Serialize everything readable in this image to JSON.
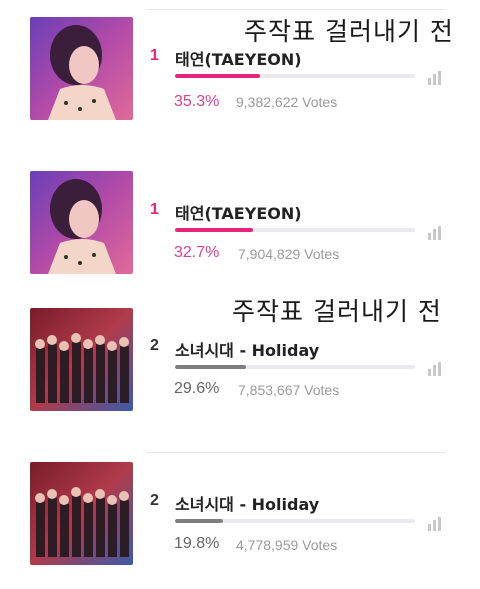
{
  "captions": [
    "주작표 걸러내기 전",
    "주작표 걸러내기 전"
  ],
  "accent_colors": {
    "pink": "#e8247a",
    "gray": "#7f7f7f"
  },
  "entries": [
    {
      "rank": "1",
      "name": "태연(TAEYEON)",
      "percent": "35.3%",
      "votes": "9,382,622 Votes",
      "share": 0.353,
      "color": "#e8247a",
      "image": "taeyeon-portrait"
    },
    {
      "rank": "1",
      "name": "태연(TAEYEON)",
      "percent": "32.7%",
      "votes": "7,904,829 Votes",
      "share": 0.327,
      "color": "#e8247a",
      "image": "taeyeon-portrait"
    },
    {
      "rank": "2",
      "name": "소녀시대 - Holiday",
      "percent": "29.6%",
      "votes": "7,853,667 Votes",
      "share": 0.296,
      "color": "#7f7f7f",
      "image": "snsd-group-photo"
    },
    {
      "rank": "2",
      "name": "소녀시대 - Holiday",
      "percent": "19.8%",
      "votes": "4,778,959 Votes",
      "share": 0.198,
      "color": "#7f7f7f",
      "image": "snsd-group-photo"
    }
  ],
  "icons": {
    "stats": "bar-chart-icon"
  }
}
